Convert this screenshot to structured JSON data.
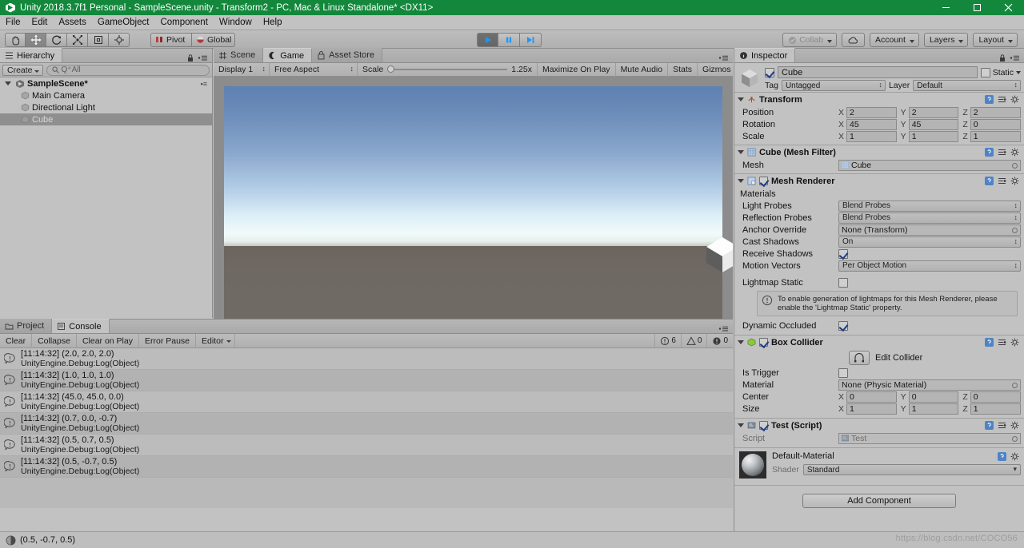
{
  "window": {
    "title": "Unity 2018.3.7f1 Personal - SampleScene.unity - Transform2 - PC, Mac & Linux Standalone* <DX11>",
    "minimize_label": "—",
    "maximize_label": "❐",
    "close_label": "✕"
  },
  "menubar": {
    "items": [
      "File",
      "Edit",
      "Assets",
      "GameObject",
      "Component",
      "Window",
      "Help"
    ]
  },
  "toolbar": {
    "tools": [
      {
        "name": "hand-tool",
        "active": false
      },
      {
        "name": "move-tool",
        "active": true
      },
      {
        "name": "rotate-tool",
        "active": false
      },
      {
        "name": "scale-tool",
        "active": false
      },
      {
        "name": "rect-tool",
        "active": false
      },
      {
        "name": "transform-tool",
        "active": false
      }
    ],
    "pivot_label": "Pivot",
    "global_label": "Global",
    "play_label": "▶",
    "pause_label": "❙❙",
    "step_label": "▶|",
    "collab_label": "Collab",
    "cloud_label": "☁",
    "account_label": "Account",
    "layers_label": "Layers",
    "layout_label": "Layout"
  },
  "hierarchy": {
    "tab_label": "Hierarchy",
    "create_label": "Create",
    "search_placeholder": "Q⁺All",
    "items": [
      {
        "label": "SampleScene*",
        "depth": 0,
        "type": "scene",
        "selected": false
      },
      {
        "label": "Main Camera",
        "depth": 1,
        "type": "object",
        "selected": false
      },
      {
        "label": "Directional Light",
        "depth": 1,
        "type": "object",
        "selected": false
      },
      {
        "label": "Cube",
        "depth": 1,
        "type": "object",
        "selected": true
      }
    ]
  },
  "gameview": {
    "tabs": [
      {
        "label": "Scene",
        "active": false
      },
      {
        "label": "Game",
        "active": true
      },
      {
        "label": "Asset Store",
        "active": false
      }
    ],
    "display_label": "Display 1",
    "aspect_label": "Free Aspect",
    "scale_label": "Scale",
    "scale_value": "1.25x",
    "maximize_label": "Maximize On Play",
    "mute_label": "Mute Audio",
    "stats_label": "Stats",
    "gizmos_label": "Gizmos"
  },
  "console": {
    "tabs": [
      {
        "label": "Project",
        "active": false
      },
      {
        "label": "Console",
        "active": true
      }
    ],
    "buttons": [
      "Clear",
      "Collapse",
      "Clear on Play",
      "Error Pause"
    ],
    "editor_label": "Editor",
    "counts": {
      "info": "6",
      "warning": "0",
      "error": "0"
    },
    "entries": [
      {
        "message": "[11:14:32] (2.0, 2.0, 2.0)",
        "stack": "UnityEngine.Debug:Log(Object)"
      },
      {
        "message": "[11:14:32] (1.0, 1.0, 1.0)",
        "stack": "UnityEngine.Debug:Log(Object)"
      },
      {
        "message": "[11:14:32] (45.0, 45.0, 0.0)",
        "stack": "UnityEngine.Debug:Log(Object)"
      },
      {
        "message": "[11:14:32] (0.7, 0.0, -0.7)",
        "stack": "UnityEngine.Debug:Log(Object)"
      },
      {
        "message": "[11:14:32] (0.5, 0.7, 0.5)",
        "stack": "UnityEngine.Debug:Log(Object)"
      },
      {
        "message": "[11:14:32] (0.5, -0.7, 0.5)",
        "stack": "UnityEngine.Debug:Log(Object)"
      }
    ]
  },
  "inspector": {
    "tab_label": "Inspector",
    "object_name": "Cube",
    "static_label": "Static",
    "tag_label": "Tag",
    "tag_value": "Untagged",
    "layer_label": "Layer",
    "layer_value": "Default",
    "transform": {
      "title": "Transform",
      "rows": [
        {
          "label": "Position",
          "x": "2",
          "y": "2",
          "z": "2"
        },
        {
          "label": "Rotation",
          "x": "45",
          "y": "45",
          "z": "0"
        },
        {
          "label": "Scale",
          "x": "1",
          "y": "1",
          "z": "1"
        }
      ],
      "axis_labels": [
        "X",
        "Y",
        "Z"
      ]
    },
    "mesh_filter": {
      "title": "Cube (Mesh Filter)",
      "mesh_label": "Mesh",
      "mesh_value": "Cube"
    },
    "mesh_renderer": {
      "title": "Mesh Renderer",
      "materials_label": "Materials",
      "rows": [
        {
          "label": "Light Probes",
          "value": "Blend Probes",
          "kind": "popup"
        },
        {
          "label": "Reflection Probes",
          "value": "Blend Probes",
          "kind": "popup"
        },
        {
          "label": "Anchor Override",
          "value": "None (Transform)",
          "kind": "object"
        },
        {
          "label": "Cast Shadows",
          "value": "On",
          "kind": "popup"
        },
        {
          "label": "Receive Shadows",
          "value": "",
          "kind": "checkbox-on"
        },
        {
          "label": "Motion Vectors",
          "value": "Per Object Motion",
          "kind": "popup"
        },
        {
          "label": "Lightmap Static",
          "value": "",
          "kind": "checkbox-off"
        }
      ],
      "helpbox": "To enable generation of lightmaps for this Mesh Renderer, please enable the 'Lightmap Static' property.",
      "dynamic_occluded_label": "Dynamic Occluded"
    },
    "box_collider": {
      "title": "Box Collider",
      "edit_collider_label": "Edit Collider",
      "is_trigger_label": "Is Trigger",
      "material_label": "Material",
      "material_value": "None (Physic Material)",
      "center": {
        "label": "Center",
        "x": "0",
        "y": "0",
        "z": "0"
      },
      "size": {
        "label": "Size",
        "x": "1",
        "y": "1",
        "z": "1"
      }
    },
    "script_component": {
      "title": "Test (Script)",
      "script_label": "Script",
      "script_value": "Test"
    },
    "material": {
      "name": "Default-Material",
      "shader_label": "Shader",
      "shader_value": "Standard"
    },
    "add_component_label": "Add Component"
  },
  "statusbar": {
    "message": "(0.5, -0.7, 0.5)"
  },
  "watermark": {
    "text": "https://blog.csdn.net/COCO56"
  },
  "colors": {
    "title_green": "#13883c",
    "panel_gray": "#c2c2c2",
    "toolbar_gray": "#b4b4b4",
    "selection_gray": "#8f8f8f",
    "play_blue": "#2196f3"
  }
}
